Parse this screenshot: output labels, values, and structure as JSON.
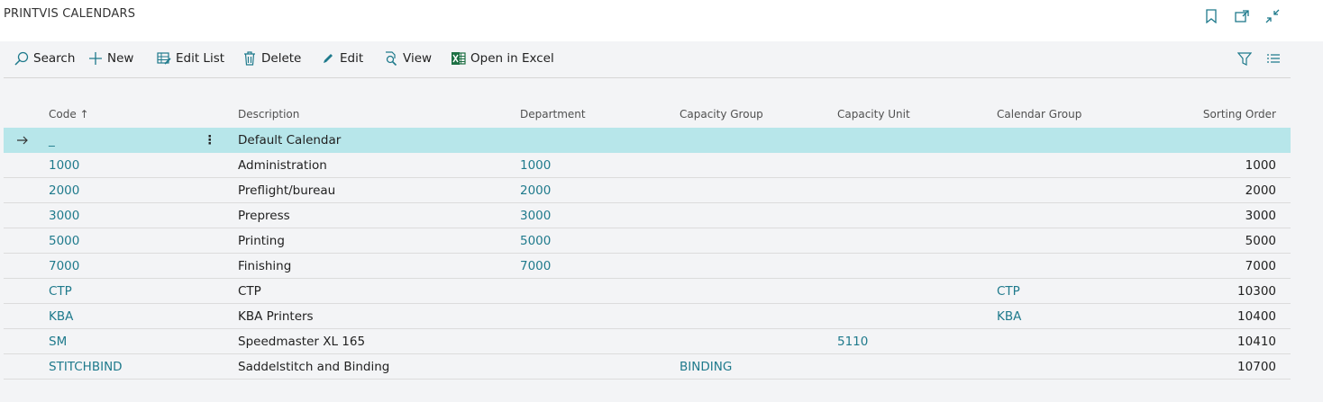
{
  "page": {
    "title": "PRINTVIS CALENDARS"
  },
  "toolbar": {
    "search": "Search",
    "new": "New",
    "edit_list": "Edit List",
    "delete": "Delete",
    "edit": "Edit",
    "view": "View",
    "open_in_excel": "Open in Excel"
  },
  "columns": {
    "code": "Code ↑",
    "description": "Description",
    "department": "Department",
    "capacity_group": "Capacity Group",
    "capacity_unit": "Capacity Unit",
    "calendar_group": "Calendar Group",
    "sorting_order": "Sorting Order"
  },
  "rows": [
    {
      "code": "_",
      "description": "Default Calendar",
      "department": "",
      "capacity_group": "",
      "capacity_unit": "",
      "calendar_group": "",
      "sorting_order": ""
    },
    {
      "code": "1000",
      "description": "Administration",
      "department": "1000",
      "capacity_group": "",
      "capacity_unit": "",
      "calendar_group": "",
      "sorting_order": "1000"
    },
    {
      "code": "2000",
      "description": "Preflight/bureau",
      "department": "2000",
      "capacity_group": "",
      "capacity_unit": "",
      "calendar_group": "",
      "sorting_order": "2000"
    },
    {
      "code": "3000",
      "description": "Prepress",
      "department": "3000",
      "capacity_group": "",
      "capacity_unit": "",
      "calendar_group": "",
      "sorting_order": "3000"
    },
    {
      "code": "5000",
      "description": "Printing",
      "department": "5000",
      "capacity_group": "",
      "capacity_unit": "",
      "calendar_group": "",
      "sorting_order": "5000"
    },
    {
      "code": "7000",
      "description": "Finishing",
      "department": "7000",
      "capacity_group": "",
      "capacity_unit": "",
      "calendar_group": "",
      "sorting_order": "7000"
    },
    {
      "code": "CTP",
      "description": "CTP",
      "department": "",
      "capacity_group": "",
      "capacity_unit": "",
      "calendar_group": "CTP",
      "sorting_order": "10300"
    },
    {
      "code": "KBA",
      "description": "KBA Printers",
      "department": "",
      "capacity_group": "",
      "capacity_unit": "",
      "calendar_group": "KBA",
      "sorting_order": "10400"
    },
    {
      "code": "SM",
      "description": "Speedmaster XL 165",
      "department": "",
      "capacity_group": "",
      "capacity_unit": "5110",
      "calendar_group": "",
      "sorting_order": "10410"
    },
    {
      "code": "STITCHBIND",
      "description": "Saddelstitch and Binding",
      "department": "",
      "capacity_group": "BINDING",
      "capacity_unit": "",
      "calendar_group": "",
      "sorting_order": "10700"
    }
  ],
  "selected_row_index": 0,
  "colors": {
    "link": "#1f7a8c",
    "selected": "#b7e6ea",
    "excel": "#1d7044"
  }
}
